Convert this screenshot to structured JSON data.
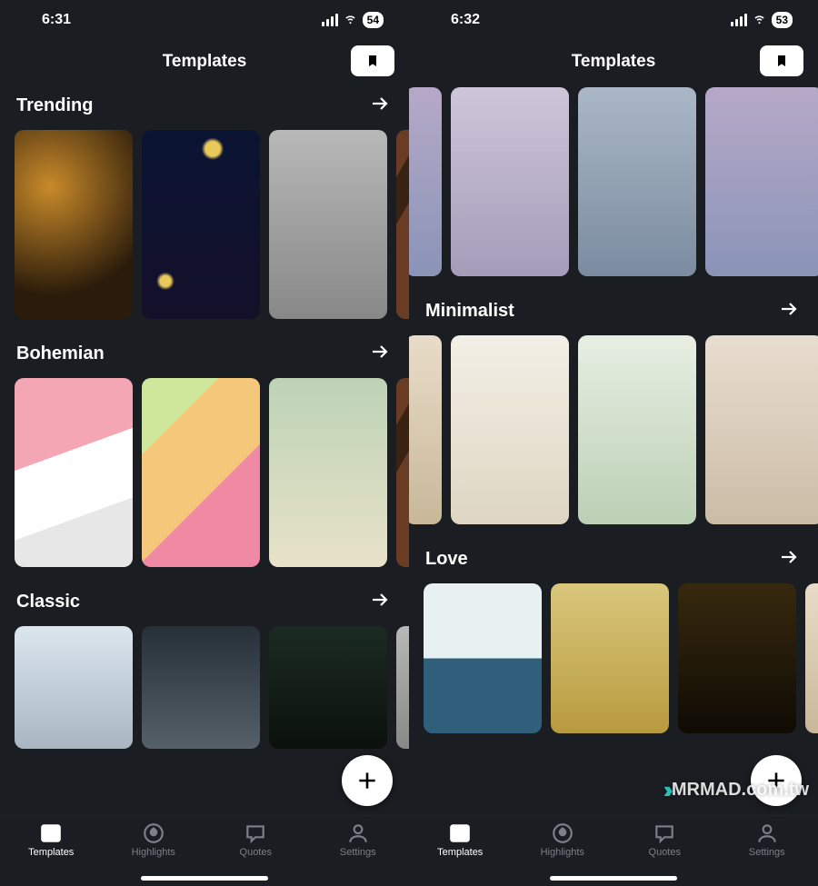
{
  "screens": [
    {
      "status": {
        "time": "6:31",
        "battery": "54"
      },
      "header": {
        "title": "Templates"
      },
      "sections": [
        {
          "title": "Trending",
          "cards": [
            "g1",
            "g2",
            "g3",
            "g4"
          ],
          "card_h": "card"
        },
        {
          "title": "Bohemian",
          "cards": [
            "g5",
            "g6",
            "g7",
            "g4"
          ],
          "card_h": "card"
        },
        {
          "title": "Classic",
          "cards": [
            "g8",
            "g9",
            "g10",
            "g3"
          ],
          "card_h": "card short"
        }
      ]
    },
    {
      "status": {
        "time": "6:32",
        "battery": "53"
      },
      "header": {
        "title": "Templates"
      },
      "top_row": [
        "g11",
        "g12",
        "g13",
        "g11"
      ],
      "sections": [
        {
          "title": "Minimalist",
          "cards": [
            "g14",
            "g15",
            "g16",
            "g17"
          ],
          "card_h": "card"
        },
        {
          "title": "Love",
          "cards": [
            "g18",
            "g19",
            "g20",
            "g14"
          ],
          "card_h": "card half"
        }
      ]
    }
  ],
  "tabs": [
    {
      "label": "Templates",
      "icon": "templates-icon",
      "active": true
    },
    {
      "label": "Highlights",
      "icon": "highlights-icon",
      "active": false
    },
    {
      "label": "Quotes",
      "icon": "quotes-icon",
      "active": false
    },
    {
      "label": "Settings",
      "icon": "settings-icon",
      "active": false
    }
  ],
  "watermark": "MRMAD.com.tw"
}
